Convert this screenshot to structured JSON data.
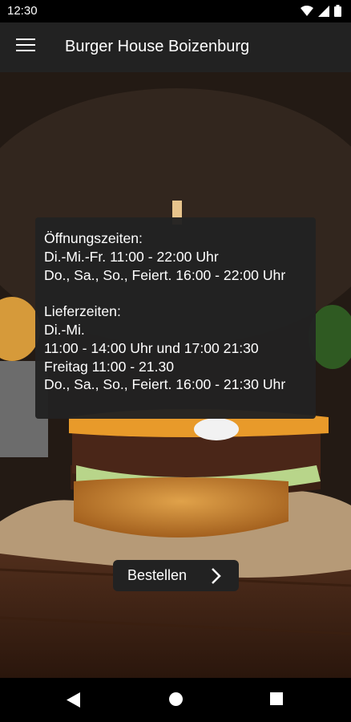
{
  "status_bar": {
    "time": "12:30"
  },
  "app_bar": {
    "title": "Burger House Boizenburg"
  },
  "hours": {
    "opening_title": "Öffnungszeiten:",
    "opening_lines": [
      "Di.-Mi.-Fr. 11:00 - 22:00 Uhr",
      "Do., Sa., So., Feiert. 16:00 - 22:00 Uhr"
    ],
    "delivery_title": "Lieferzeiten:",
    "delivery_lines": [
      "Di.-Mi.",
      "11:00 - 14:00 Uhr und 17:00 21:30",
      "Freitag 11:00 - 21.30",
      "Do., Sa., So., Feiert. 16:00 - 21:30 Uhr"
    ]
  },
  "order_button": {
    "label": "Bestellen"
  },
  "colors": {
    "app_bar": "#222222",
    "status_bar": "#000000",
    "nav_bar": "#000000",
    "card": "#222222"
  },
  "icons": [
    "wifi-icon",
    "signal-icon",
    "battery-icon",
    "menu-icon",
    "chevron-right-icon",
    "back-icon",
    "home-icon",
    "recents-icon"
  ]
}
